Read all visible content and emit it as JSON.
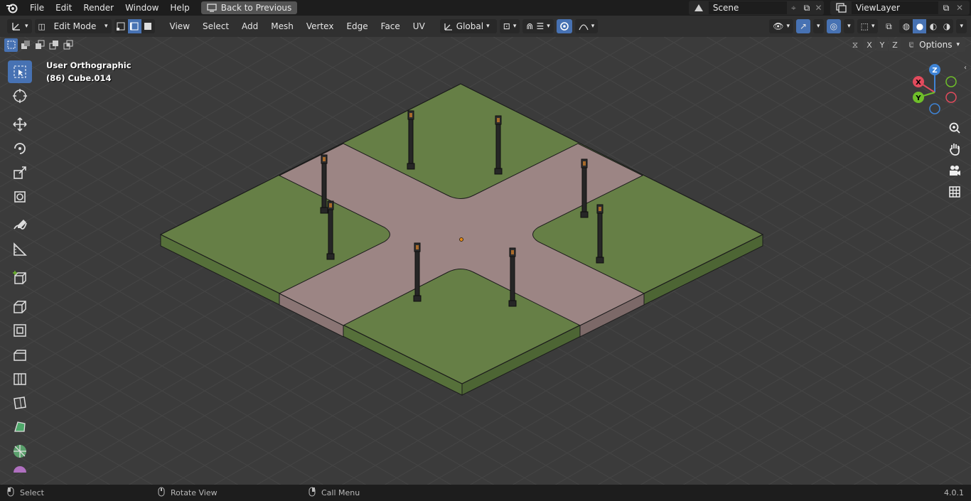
{
  "menu": {
    "file": "File",
    "edit": "Edit",
    "render": "Render",
    "window": "Window",
    "help": "Help",
    "back_label": "Back to Previous"
  },
  "scene": {
    "name": "Scene",
    "view_layer": "ViewLayer"
  },
  "header": {
    "mode": "Edit Mode",
    "view": "View",
    "select": "Select",
    "add": "Add",
    "mesh": "Mesh",
    "vertex": "Vertex",
    "edge": "Edge",
    "face": "Face",
    "uv": "UV",
    "orientation": "Global",
    "options": "Options",
    "axis_x": "X",
    "axis_y": "Y",
    "axis_z": "Z"
  },
  "viewport": {
    "view_name": "User Orthographic",
    "object_info": "(86) Cube.014",
    "gizmo": {
      "x": "X",
      "y": "Y",
      "z": "Z"
    }
  },
  "status": {
    "select": "Select",
    "rotate": "Rotate View",
    "call_menu": "Call Menu",
    "version": "4.0.1"
  },
  "colors": {
    "grass": "#667f46",
    "road": "#9c8584",
    "accent": "#4772b3",
    "grid_bg": "#3a3a3a"
  },
  "icons": [
    "blender-logo-icon",
    "select-box-icon",
    "cursor-icon",
    "move-icon",
    "rotate-icon",
    "scale-icon",
    "transform-icon",
    "annotate-icon",
    "measure-icon",
    "add-cube-icon",
    "extrude-icon",
    "inset-icon",
    "bevel-icon",
    "loop-cut-icon",
    "knife-icon",
    "poly-build-icon",
    "spin-icon",
    "smooth-icon"
  ]
}
